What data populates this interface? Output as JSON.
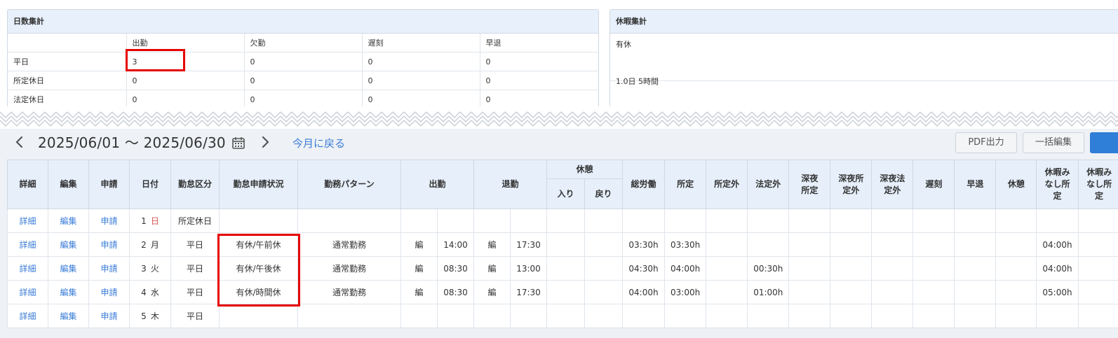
{
  "days_summary": {
    "title": "日数集計",
    "columns": [
      "",
      "出勤",
      "欠勤",
      "遅刻",
      "早退"
    ],
    "rows": [
      {
        "label": "平日",
        "values": [
          "3",
          "0",
          "0",
          "0"
        ]
      },
      {
        "label": "所定休日",
        "values": [
          "0",
          "0",
          "0",
          "0"
        ]
      },
      {
        "label": "法定休日",
        "values": [
          "0",
          "0",
          "0",
          "0"
        ]
      }
    ]
  },
  "leave_summary": {
    "title": "休暇集計",
    "label": "有休",
    "value": "1.0日 5時間"
  },
  "nav": {
    "range": "2025/06/01 〜 2025/06/30",
    "today_link": "今月に戻る",
    "prev_icon": "chevron-left-icon",
    "next_icon": "chevron-right-icon",
    "calendar_icon": "calendar-icon"
  },
  "buttons": {
    "pdf": "PDF出力",
    "bulk_edit": "一括編集"
  },
  "table": {
    "headers": {
      "detail": "詳細",
      "edit": "編集",
      "apply": "申請",
      "date": "日付",
      "category": "勤怠区分",
      "status": "勤怠申請状況",
      "pattern": "勤務パターン",
      "clock_in": "出勤",
      "clock_out": "退勤",
      "break": "休憩",
      "break_in": "入り",
      "break_out": "戻り",
      "total": "総労働",
      "scheduled": "所定",
      "non_scheduled": "所定外",
      "non_statutory": "法定外",
      "night_scheduled": "深夜所定",
      "night_non_scheduled": "深夜所定外",
      "night_non_statutory": "深夜法定外",
      "late": "遅刻",
      "early": "早退",
      "rest": "休憩",
      "leave_deemed_scheduled": "休暇みなし所定",
      "leave_deemed_scheduled_2": "休暇みなし所定"
    },
    "rows": [
      {
        "detail": "詳細",
        "edit": "編集",
        "apply": "申請",
        "day": "1",
        "weekday": "日",
        "category": "所定休日",
        "status": "",
        "pattern": "",
        "in_edit": "",
        "in_time": "",
        "out_edit": "",
        "out_time": "",
        "total": "",
        "scheduled": "",
        "non_statutory": "",
        "leave_deemed": ""
      },
      {
        "detail": "詳細",
        "edit": "編集",
        "apply": "申請",
        "day": "2",
        "weekday": "月",
        "category": "平日",
        "status": "有休/午前休",
        "pattern": "通常勤務",
        "in_edit": "編",
        "in_time": "14:00",
        "out_edit": "編",
        "out_time": "17:30",
        "total": "03:30h",
        "scheduled": "03:30h",
        "non_statutory": "",
        "leave_deemed": "04:00h"
      },
      {
        "detail": "詳細",
        "edit": "編集",
        "apply": "申請",
        "day": "3",
        "weekday": "火",
        "category": "平日",
        "status": "有休/午後休",
        "pattern": "通常勤務",
        "in_edit": "編",
        "in_time": "08:30",
        "out_edit": "編",
        "out_time": "13:00",
        "total": "04:30h",
        "scheduled": "04:00h",
        "non_statutory": "00:30h",
        "leave_deemed": "04:00h"
      },
      {
        "detail": "詳細",
        "edit": "編集",
        "apply": "申請",
        "day": "4",
        "weekday": "水",
        "category": "平日",
        "status": "有休/時間休",
        "pattern": "通常勤務",
        "in_edit": "編",
        "in_time": "08:30",
        "out_edit": "編",
        "out_time": "17:30",
        "total": "04:00h",
        "scheduled": "03:00h",
        "non_statutory": "01:00h",
        "leave_deemed": "05:00h"
      },
      {
        "detail": "詳細",
        "edit": "編集",
        "apply": "申請",
        "day": "5",
        "weekday": "木",
        "category": "平日",
        "status": "",
        "pattern": "",
        "in_edit": "",
        "in_time": "",
        "out_edit": "",
        "out_time": "",
        "total": "",
        "scheduled": "",
        "non_statutory": "",
        "leave_deemed": ""
      }
    ]
  },
  "colors": {
    "header_bg": "#e6effa",
    "link": "#3b7dd8",
    "highlight": "#e60000",
    "primary_button": "#2f7ed8",
    "sunday": "#d9534f"
  }
}
